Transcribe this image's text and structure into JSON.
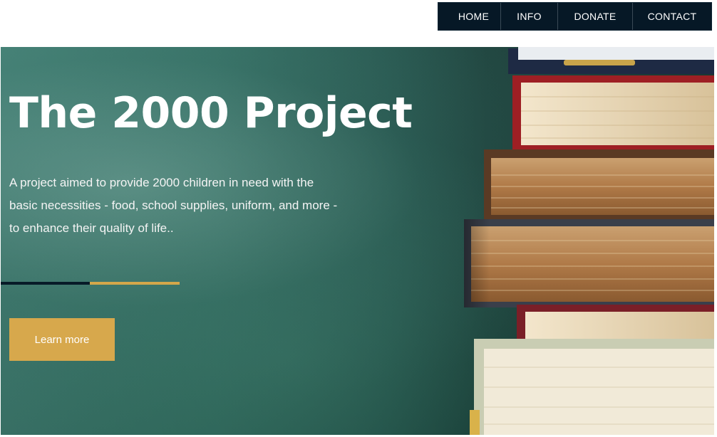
{
  "nav": {
    "items": [
      {
        "label": "HOME"
      },
      {
        "label": "INFO"
      },
      {
        "label": "DONATE"
      },
      {
        "label": "CONTACT"
      }
    ],
    "background": "#061826"
  },
  "hero": {
    "title": "The 2000 Project",
    "description": "A project aimed to provide 2000 children in need with the basic necessities - food, school supplies, uniform, and more - to enhance their quality of life..",
    "cta_label": "Learn more",
    "accent_color": "#d7a84c",
    "image": "stack-of-books-on-green-chalkboard"
  }
}
